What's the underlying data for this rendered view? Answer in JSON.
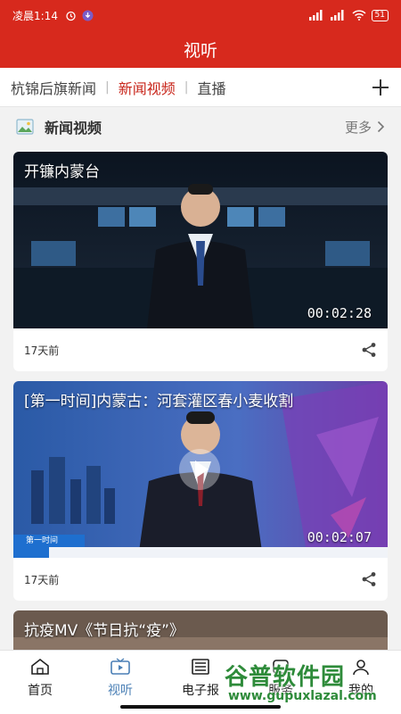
{
  "status_bar": {
    "time": "凌晨1:14",
    "battery": "51"
  },
  "header": {
    "title": "视听"
  },
  "tabs": [
    {
      "label": "杭锦后旗新闻",
      "active": false
    },
    {
      "label": "新闻视频",
      "active": true
    },
    {
      "label": "直播",
      "active": false
    }
  ],
  "section": {
    "title": "新闻视频",
    "more": "更多"
  },
  "videos": [
    {
      "title": "开镰内蒙台",
      "duration": "00:02:28",
      "time": "17天前"
    },
    {
      "title": "[第一时间]内蒙古：河套灌区春小麦收割",
      "duration": "00:02:07",
      "time": "17天前",
      "lower_third": "第一时间"
    },
    {
      "title": "抗疫MV《节日抗“疫”》"
    }
  ],
  "nav": [
    {
      "label": "首页",
      "icon": "home-icon",
      "active": false
    },
    {
      "label": "视听",
      "icon": "tv-icon",
      "active": true
    },
    {
      "label": "电子报",
      "icon": "newspaper-icon",
      "active": false
    },
    {
      "label": "服务",
      "icon": "service-icon",
      "active": false
    },
    {
      "label": "我的",
      "icon": "user-icon",
      "active": false
    }
  ],
  "watermark": {
    "brand": "谷普软件园",
    "url": "www.gupuxlazal.com"
  },
  "colors": {
    "brand_red": "#d7291d",
    "active_tab": "#c8251a",
    "active_nav": "#4a7fb5"
  }
}
